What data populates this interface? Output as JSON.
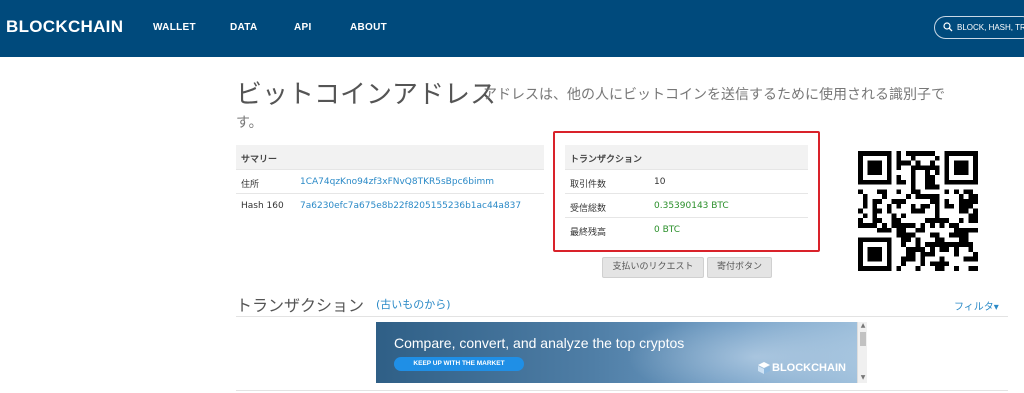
{
  "nav": {
    "logo": "BLOCKCHAIN",
    "links": [
      "WALLET",
      "DATA",
      "API",
      "ABOUT"
    ],
    "search_placeholder": "BLOCK, HASH, TRA"
  },
  "heading": {
    "title": "ビットコインアドレス",
    "subtitle_line1": "アドレスは、他の人にビットコインを送信するために使用される識別子で",
    "subtitle_line2": "す。"
  },
  "summary": {
    "header": "サマリー",
    "rows": [
      {
        "label": "住所",
        "value": "1CA74qzKno94zf3xFNvQ8TKR5sBpc6bimm"
      },
      {
        "label": "Hash 160",
        "value": "7a6230efc7a675e8b22f8205155236b1ac44a837"
      }
    ]
  },
  "transactions": {
    "header": "トランザクション",
    "rows": [
      {
        "label": "取引件数",
        "value": "10"
      },
      {
        "label": "受信総数",
        "value": "0.35390143 BTC"
      },
      {
        "label": "最終残高",
        "value": "0 BTC"
      }
    ]
  },
  "buttons": {
    "request_payment": "支払いのリクエスト",
    "donate": "寄付ボタン"
  },
  "tx_section": {
    "title": "トランザクション",
    "order": "(古いものから)",
    "filter": "フィルタ▾"
  },
  "ad": {
    "headline": "Compare, convert, and analyze the top cryptos",
    "button": "KEEP UP WITH THE MARKET",
    "brand": "BLOCKCHAIN"
  },
  "colors": {
    "nav_bg": "#004a7c",
    "link": "#2b8ac7",
    "green": "#2a8f2a",
    "highlight": "#d9222a"
  }
}
